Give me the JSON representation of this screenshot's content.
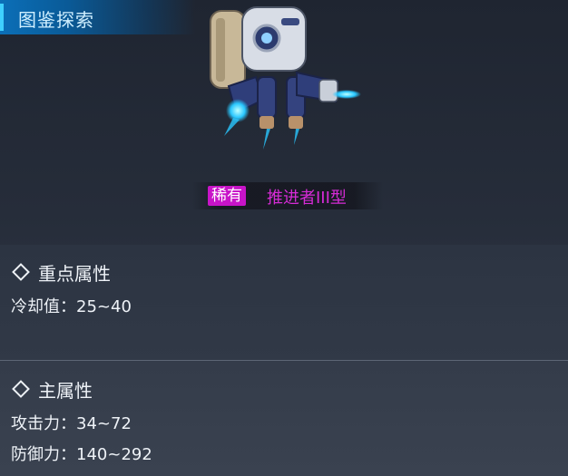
{
  "header": {
    "title": "图鉴探索"
  },
  "item": {
    "rarity": "稀有",
    "name": "推进者III型"
  },
  "section_key": {
    "title": "重点属性",
    "attrs": [
      {
        "text": "冷却值：25~40"
      }
    ]
  },
  "section_main": {
    "title": "主属性",
    "attrs": [
      {
        "text": "攻击力：34~72"
      },
      {
        "text": "防御力：140~292"
      }
    ]
  },
  "colors": {
    "rarity_badge": "#c814c8",
    "item_name": "#d62bd6",
    "title_bar": "#0b6fb8"
  }
}
